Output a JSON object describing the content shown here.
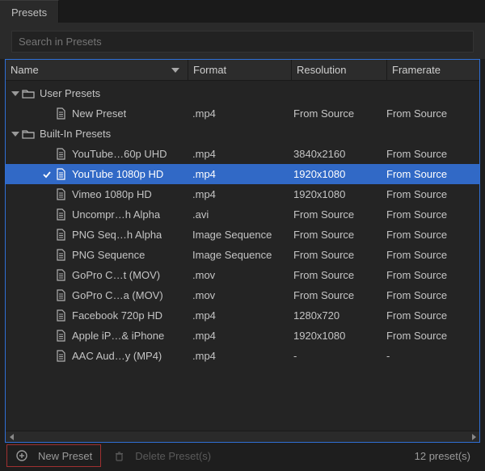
{
  "tab": {
    "title": "Presets"
  },
  "search": {
    "placeholder": "Search in Presets"
  },
  "headers": {
    "name": "Name",
    "format": "Format",
    "resolution": "Resolution",
    "framerate": "Framerate"
  },
  "groups": [
    {
      "label": "User Presets",
      "rows": [
        {
          "name": "New Preset",
          "format": ".mp4",
          "resolution": "From Source",
          "framerate": "From Source",
          "selected": false,
          "checked": false
        }
      ]
    },
    {
      "label": "Built-In Presets",
      "rows": [
        {
          "name": "YouTube…60p UHD",
          "format": ".mp4",
          "resolution": "3840x2160",
          "framerate": "From Source",
          "selected": false,
          "checked": false
        },
        {
          "name": "YouTube 1080p HD",
          "format": ".mp4",
          "resolution": "1920x1080",
          "framerate": "From Source",
          "selected": true,
          "checked": true
        },
        {
          "name": "Vimeo 1080p HD",
          "format": ".mp4",
          "resolution": "1920x1080",
          "framerate": "From Source",
          "selected": false,
          "checked": false
        },
        {
          "name": "Uncompr…h Alpha",
          "format": ".avi",
          "resolution": "From Source",
          "framerate": "From Source",
          "selected": false,
          "checked": false
        },
        {
          "name": "PNG Seq…h Alpha",
          "format": "Image Sequence",
          "resolution": "From Source",
          "framerate": "From Source",
          "selected": false,
          "checked": false
        },
        {
          "name": "PNG Sequence",
          "format": "Image Sequence",
          "resolution": "From Source",
          "framerate": "From Source",
          "selected": false,
          "checked": false
        },
        {
          "name": "GoPro C…t (MOV)",
          "format": ".mov",
          "resolution": "From Source",
          "framerate": "From Source",
          "selected": false,
          "checked": false
        },
        {
          "name": "GoPro C…a (MOV)",
          "format": ".mov",
          "resolution": "From Source",
          "framerate": "From Source",
          "selected": false,
          "checked": false
        },
        {
          "name": "Facebook 720p HD",
          "format": ".mp4",
          "resolution": "1280x720",
          "framerate": "From Source",
          "selected": false,
          "checked": false
        },
        {
          "name": "Apple iP…& iPhone",
          "format": ".mp4",
          "resolution": "1920x1080",
          "framerate": "From Source",
          "selected": false,
          "checked": false
        },
        {
          "name": "AAC Aud…y (MP4)",
          "format": ".mp4",
          "resolution": "-",
          "framerate": "-",
          "selected": false,
          "checked": false
        }
      ]
    }
  ],
  "footer": {
    "new_label": "New Preset",
    "delete_label": "Delete Preset(s)",
    "count_label": "12 preset(s)"
  }
}
